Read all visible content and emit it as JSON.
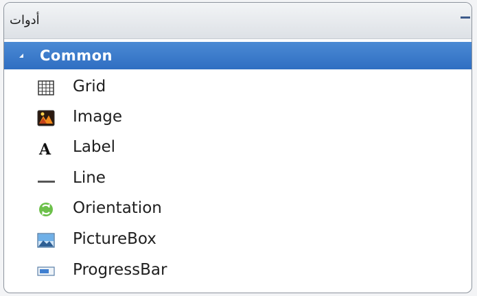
{
  "window": {
    "title": "أدوات"
  },
  "category": {
    "label": "Common"
  },
  "items": [
    {
      "label": "Grid",
      "icon": "grid-icon"
    },
    {
      "label": "Image",
      "icon": "image-icon"
    },
    {
      "label": "Label",
      "icon": "label-icon"
    },
    {
      "label": "Line",
      "icon": "line-icon"
    },
    {
      "label": "Orientation",
      "icon": "orientation-icon"
    },
    {
      "label": "PictureBox",
      "icon": "picturebox-icon"
    },
    {
      "label": "ProgressBar",
      "icon": "progressbar-icon"
    }
  ],
  "colors": {
    "accent": "#3a7bcf",
    "text": "#1f1f1f"
  }
}
